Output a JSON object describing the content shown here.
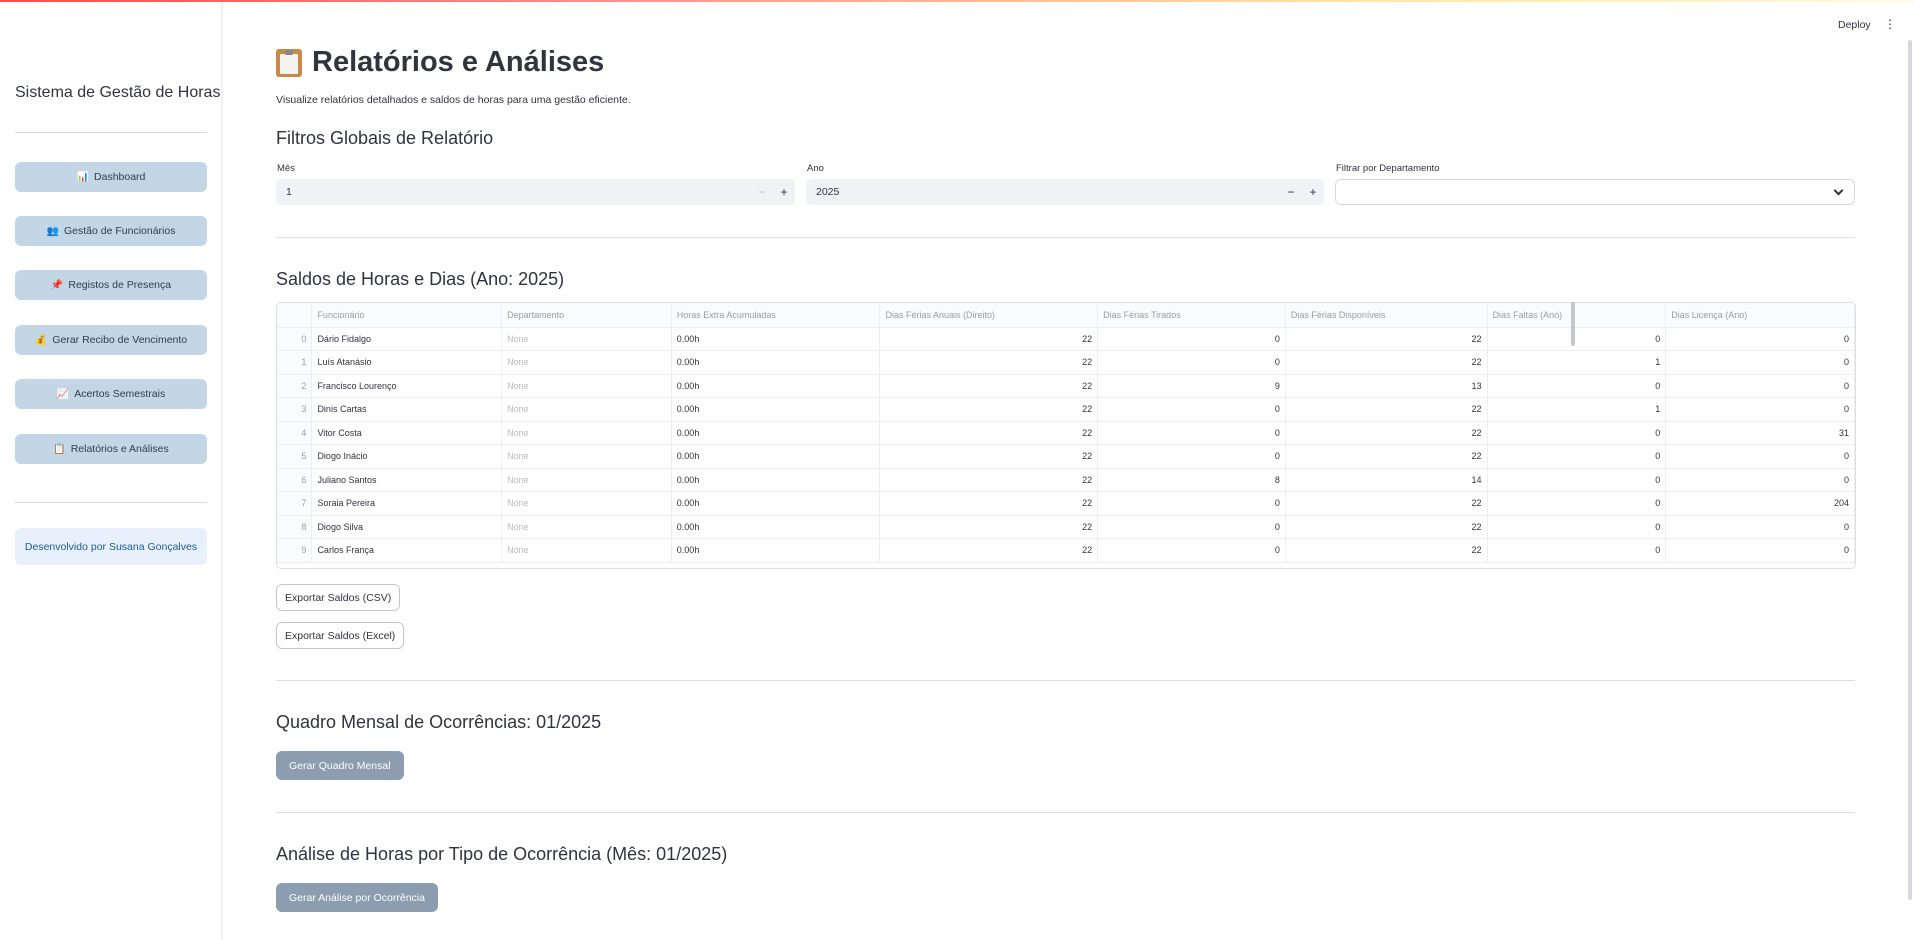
{
  "header": {
    "deploy_label": "Deploy",
    "menu_icon": "⋮"
  },
  "sidebar": {
    "title": "Sistema de Gestão de Horas",
    "items": [
      {
        "icon": "📊",
        "label": "Dashboard"
      },
      {
        "icon": "👥",
        "label": "Gestão de Funcionários"
      },
      {
        "icon": "📌",
        "label": "Registos de Presença"
      },
      {
        "icon": "💰",
        "label": "Gerar Recibo de Vencimento"
      },
      {
        "icon": "📈",
        "label": "Acertos Semestrais"
      },
      {
        "icon": "📋",
        "label": "Relatórios e Análises"
      }
    ],
    "credit": "Desenvolvido por Susana Gonçalves"
  },
  "main": {
    "title": "Relatórios e Análises",
    "subtitle": "Visualize relatórios detalhados e saldos de horas para uma gestão eficiente.",
    "filters": {
      "heading": "Filtros Globais de Relatório",
      "month_label": "Mês",
      "month_value": "1",
      "year_label": "Ano",
      "year_value": "2025",
      "dept_label": "Filtrar por Departamento",
      "dept_value": ""
    },
    "balances": {
      "heading": "Saldos de Horas e Dias (Ano: 2025)",
      "columns": [
        "",
        "Funcionário",
        "Departamento",
        "Horas Extra Acumuladas",
        "Dias Férias Anuais (Direito)",
        "Dias Férias Tirados",
        "Dias Férias Disponíveis",
        "Dias Faltas (Ano)",
        "Dias Licença (Ano)"
      ],
      "rows": [
        [
          "0",
          "Dário Fidalgo",
          "None",
          "0.00h",
          "22",
          "0",
          "22",
          "0",
          "0"
        ],
        [
          "1",
          "Luís Atanásio",
          "None",
          "0.00h",
          "22",
          "0",
          "22",
          "1",
          "0"
        ],
        [
          "2",
          "Francisco Lourenço",
          "None",
          "0.00h",
          "22",
          "9",
          "13",
          "0",
          "0"
        ],
        [
          "3",
          "Dinis Cartas",
          "None",
          "0.00h",
          "22",
          "0",
          "22",
          "1",
          "0"
        ],
        [
          "4",
          "Vitor Costa",
          "None",
          "0.00h",
          "22",
          "0",
          "22",
          "0",
          "31"
        ],
        [
          "5",
          "Diogo Inácio",
          "None",
          "0.00h",
          "22",
          "0",
          "22",
          "0",
          "0"
        ],
        [
          "6",
          "Juliano Santos",
          "None",
          "0.00h",
          "22",
          "8",
          "14",
          "0",
          "0"
        ],
        [
          "7",
          "Soraia Pereira",
          "None",
          "0.00h",
          "22",
          "0",
          "22",
          "0",
          "204"
        ],
        [
          "8",
          "Diogo Silva",
          "None",
          "0.00h",
          "22",
          "0",
          "22",
          "0",
          "0"
        ],
        [
          "9",
          "Carlos França",
          "None",
          "0.00h",
          "22",
          "0",
          "22",
          "0",
          "0"
        ]
      ],
      "export_csv": "Exportar Saldos (CSV)",
      "export_excel": "Exportar Saldos (Excel)"
    },
    "monthly": {
      "heading": "Quadro Mensal de Ocorrências: 01/2025",
      "button": "Gerar Quadro Mensal"
    },
    "analysis": {
      "heading": "Análise de Horas por Tipo de Ocorrência (Mês: 01/2025)",
      "button": "Gerar Análise por Ocorrência"
    }
  }
}
